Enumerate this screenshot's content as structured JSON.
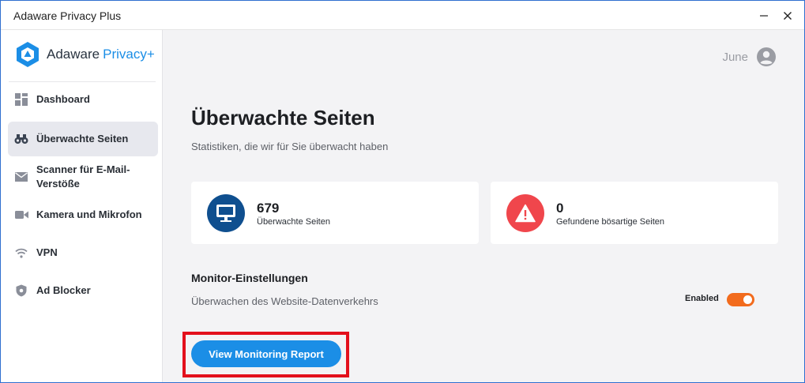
{
  "window": {
    "title": "Adaware Privacy Plus"
  },
  "brand": {
    "name": "Adaware",
    "accent": "Privacy+",
    "accent_color": "#1b8ee6"
  },
  "sidebar": {
    "items": [
      {
        "label": "Dashboard",
        "icon": "dashboard-grid-icon",
        "active": false
      },
      {
        "label": "Überwachte Seiten",
        "icon": "binoculars-icon",
        "active": true
      },
      {
        "label": "Scanner für E-Mail-Verstöße",
        "icon": "envelope-icon",
        "active": false
      },
      {
        "label": "Kamera und Mikrofon",
        "icon": "camera-icon",
        "active": false
      },
      {
        "label": "VPN",
        "icon": "wifi-icon",
        "active": false
      },
      {
        "label": "Ad Blocker",
        "icon": "shield-icon",
        "active": false
      }
    ]
  },
  "user": {
    "name": "June",
    "icon": "user-avatar-icon"
  },
  "page": {
    "title": "Überwachte Seiten",
    "subtitle": "Statistiken, die wir für Sie überwacht haben"
  },
  "stats": [
    {
      "value": "679",
      "caption": "Überwachte Seiten",
      "icon": "monitor-icon",
      "color": "#0f4f8f"
    },
    {
      "value": "0",
      "caption": "Gefundene bösartige Seiten",
      "icon": "warning-icon",
      "color": "#f0464c"
    }
  ],
  "monitor": {
    "title": "Monitor-Einstellungen",
    "description": "Überwachen des Website-Datenverkehrs",
    "toggle_label": "Enabled",
    "toggle_on": true,
    "toggle_color": "#f26b1d"
  },
  "actions": {
    "report_button": "View Monitoring Report"
  }
}
